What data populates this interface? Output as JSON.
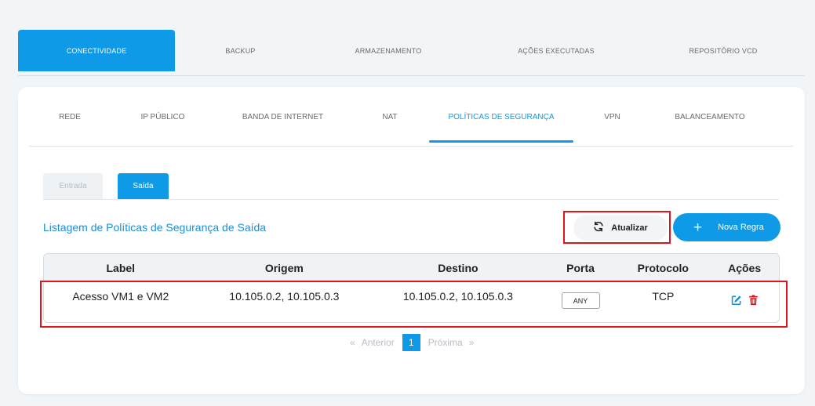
{
  "top_tabs": [
    {
      "label": "CONECTIVIDADE",
      "active": true
    },
    {
      "label": "BACKUP"
    },
    {
      "label": "ARMAZENAMENTO"
    },
    {
      "label": "AÇÕES EXECUTADAS"
    },
    {
      "label": "REPOSITÓRIO VCD"
    }
  ],
  "sub_tabs": [
    {
      "label": "REDE"
    },
    {
      "label": "IP PÚBLICO"
    },
    {
      "label": "BANDA DE INTERNET"
    },
    {
      "label": "NAT"
    },
    {
      "label": "POLÍTICAS DE SEGURANÇA",
      "active": true
    },
    {
      "label": "VPN"
    },
    {
      "label": "BALANCEAMENTO"
    }
  ],
  "direction_tabs": {
    "inbound": "Entrada",
    "outbound": "Saída"
  },
  "list_title": "Listagem de Políticas de Segurança de Saída",
  "buttons": {
    "refresh": "Atualizar",
    "add_rule": "Nova Regra"
  },
  "table": {
    "headers": [
      "Label",
      "Origem",
      "Destino",
      "Porta",
      "Protocolo",
      "Ações"
    ],
    "rows": [
      {
        "label": "Acesso VM1 e VM2",
        "origin": "10.105.0.2, 10.105.0.3",
        "destination": "10.105.0.2, 10.105.0.3",
        "port": "ANY",
        "protocol": "TCP"
      }
    ]
  },
  "pagination": {
    "prev_symbol": "«",
    "prev": "Anterior",
    "current": "1",
    "next": "Próxima",
    "next_symbol": "»"
  },
  "colors": {
    "accent": "#0e9ae6",
    "highlight": "#e0141b",
    "edit_icon": "#1a8fd6",
    "delete_icon": "#e0141b"
  },
  "icons": {
    "refresh": "refresh-icon",
    "add": "plus-icon",
    "edit": "edit-icon",
    "delete": "trash-icon"
  }
}
